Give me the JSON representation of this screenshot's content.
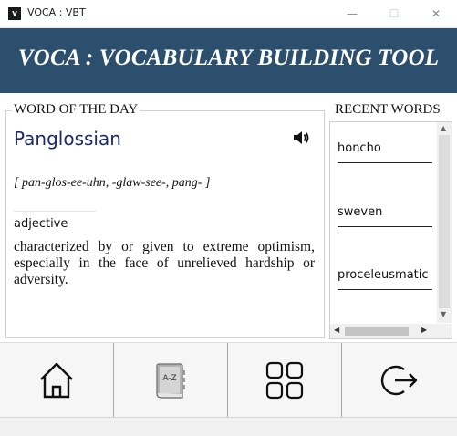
{
  "window": {
    "icon_letter": "v",
    "title": "VOCA : VBT",
    "minimize": "—",
    "maximize": "☐",
    "close": "✕"
  },
  "banner": {
    "title": "VOCA : VOCABULARY BUILDING TOOL"
  },
  "word_of_the_day": {
    "heading": "WORD OF THE DAY",
    "word": "Panglossian",
    "pronunciation": "[ pan-glos-ee-uhn, -glaw-see-, pang-  ]",
    "part_of_speech": "adjective",
    "definition": "characterized by or given to extreme optimism, especially in the face of unrelieved hardship or adversity.",
    "speaker_icon": "speaker-icon"
  },
  "recent": {
    "heading": "RECENT WORDS",
    "items": [
      "honcho",
      "sweven",
      "proceleusmatic"
    ]
  },
  "nav": {
    "items": [
      {
        "name": "home",
        "icon": "home-icon"
      },
      {
        "name": "dictionary",
        "icon": "a-z-book-icon"
      },
      {
        "name": "categories",
        "icon": "grid-icon"
      },
      {
        "name": "exit",
        "icon": "exit-icon"
      }
    ]
  },
  "colors": {
    "banner": "#2d4f6e",
    "word": "#1c2a6b"
  }
}
